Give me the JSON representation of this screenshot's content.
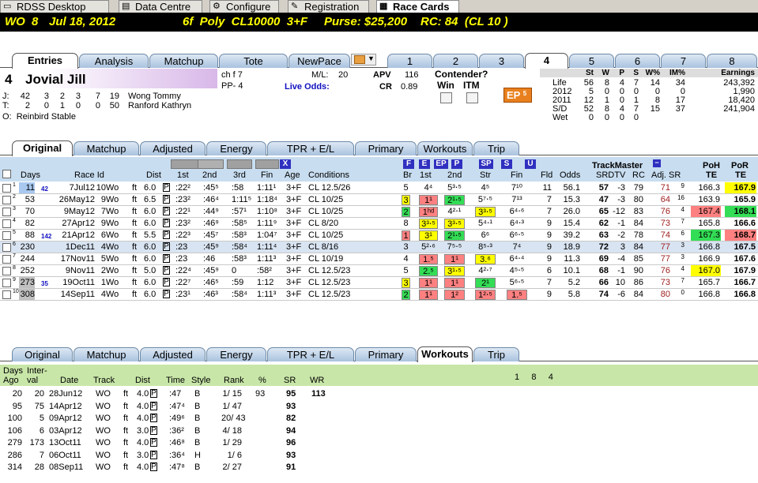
{
  "app_tabs": [
    {
      "label": "RDSS Desktop",
      "icon": "desktop-icon"
    },
    {
      "label": "Data Centre",
      "icon": "database-icon"
    },
    {
      "label": "Configure",
      "icon": "gear-icon"
    },
    {
      "label": "Registration",
      "icon": "registration-icon"
    },
    {
      "label": "Race Cards",
      "icon": "race-card-icon"
    }
  ],
  "header": {
    "track": "WO",
    "race": "8",
    "date": "Jul 18, 2012",
    "conditions": "6f  Poly  CL10000  3+F",
    "purse": "Purse: $25,200",
    "rc": "RC: 84  (CL 10 )"
  },
  "main_tabs": [
    "Entries",
    "Analysis",
    "Matchup",
    "Tote",
    "NewPace"
  ],
  "horse_tabs": [
    "1",
    "2",
    "3",
    "4",
    "5",
    "6",
    "7",
    "8"
  ],
  "horse": {
    "pp": "4",
    "name": "Jovial Jill",
    "desc": "ch f 7",
    "pp_label": "PP- 4",
    "ml_label": "M/L:",
    "ml": "20",
    "live_odds": "Live Odds:",
    "apv_label": "APV",
    "apv": "116",
    "cr_label": "CR",
    "cr": "0.89",
    "contender": "Contender?",
    "win": "Win",
    "itm": "ITM",
    "ep": "EP",
    "ep_num": "5",
    "jockey": {
      "tag": "J:",
      "stats": [
        "42",
        "3",
        "2",
        "3",
        "7",
        "19"
      ],
      "name": "Wong Tommy"
    },
    "trainer": {
      "tag": "T:",
      "stats": [
        "2",
        "0",
        "1",
        "0",
        "0",
        "50"
      ],
      "name": "Ranford Kathryn"
    },
    "owner": "O:  Reinbird Stable"
  },
  "record": {
    "headers": [
      "St",
      "W",
      "P",
      "S",
      "W%",
      "IM%",
      "Earnings"
    ],
    "rows": [
      [
        "Life",
        "56",
        "8",
        "4",
        "7",
        "14",
        "34",
        "243,392"
      ],
      [
        "2012",
        "5",
        "0",
        "0",
        "0",
        "0",
        "0",
        "1,990"
      ],
      [
        "2011",
        "12",
        "1",
        "0",
        "1",
        "8",
        "17",
        "18,420"
      ],
      [
        "S/D",
        "52",
        "8",
        "4",
        "7",
        "15",
        "37",
        "241,904"
      ],
      [
        "Wet",
        "0",
        "0",
        "0",
        "0",
        "",
        "",
        ""
      ]
    ]
  },
  "pp_tabs": [
    "Original",
    "Matchup",
    "Adjusted",
    "Energy",
    "TPR + E/L",
    "Primary",
    "Workouts",
    "Trip"
  ],
  "pp_headers": {
    "days": "Days",
    "race_id": "Race Id",
    "dist": "Dist",
    "first": "1st",
    "second": "2nd",
    "third": "3rd",
    "fin": "Fin",
    "age": "Age",
    "conditions": "Conditions",
    "br": "Br",
    "c1st": "1st",
    "c2nd": "2nd",
    "str": "Str",
    "cfin": "Fin",
    "fld": "Fld",
    "odds": "Odds",
    "trackmaster": "TrackMaster",
    "srdtv": "SRDTV",
    "rc": "RC",
    "adj_sr": "Adj. SR",
    "poh": "PoH",
    "por": "PoR",
    "te": "TE",
    "x": "X",
    "filter_labels": [
      "F",
      "E",
      "EP",
      "P",
      "SP",
      "S",
      "U"
    ]
  },
  "pp_rows": [
    {
      "n": "1",
      "days": "11",
      "small": "42",
      "date": "7Jul12",
      "race": "10",
      "trk": "Wo",
      "sf": "ft",
      "dist": "6.0",
      "f": ":22²",
      ":s": ":45⁵",
      "t": ":58",
      "fin": "1:11¹",
      "age": "3+F",
      "cond": "CL 12.5/26",
      "br": "5",
      "c1": "4⁴",
      "c1c": "",
      "c2": "5³⋅⁵",
      "c2c": "",
      "st": "4⁵",
      "stc": "",
      "fn": "7¹⁰",
      "fnc": "",
      "fld": "11",
      "odds": "56.1",
      "sr": "57",
      "dtv": "-3",
      "rc": "79",
      "adj": "71",
      "adjn": "9",
      "poh": "166.3",
      "pohc": "",
      "por": "167.9",
      "porc": "y"
    },
    {
      "n": "2",
      "days": "53",
      "small": "",
      "date": "26May12",
      "race": "9",
      "trk": "Wo",
      "sf": "ft",
      "dist": "6.5",
      "f": ":23²",
      ":s": ":46⁴",
      "t": "1:11⁵",
      "fin": "1:18⁴",
      "age": "3+F",
      "cond": "CL 10/25",
      "br": "3",
      "brc": "y",
      "c1": "1¹",
      "c1c": "p",
      "c2": "2¹⋅⁵",
      "c2c": "g",
      "st": "5⁷⋅⁵",
      "stc": "",
      "fn": "7¹³",
      "fnc": "",
      "fld": "7",
      "odds": "15.3",
      "sr": "47",
      "dtv": "-3",
      "rc": "80",
      "adj": "64",
      "adjn": "16",
      "poh": "163.9",
      "pohc": "",
      "por": "165.9",
      "porc": ""
    },
    {
      "n": "3",
      "days": "70",
      "small": "",
      "date": "9May12",
      "race": "7",
      "trk": "Wo",
      "sf": "ft",
      "dist": "6.0",
      "f": ":22¹",
      ":s": ":44⁹",
      "t": ":57¹",
      "fin": "1:10⁸",
      "age": "3+F",
      "cond": "CL 10/25",
      "br": "2",
      "brc": "g",
      "c1": "1ʰᵈ",
      "c1c": "p",
      "c2": "4²⋅¹",
      "c2c": "",
      "st": "3³⋅⁵",
      "stc": "y",
      "fn": "6⁴⋅⁶",
      "fnc": "",
      "fld": "7",
      "odds": "26.0",
      "sr": "65",
      "dtv": "-12",
      "rc": "83",
      "adj": "76",
      "adjn": "4",
      "poh": "167.4",
      "pohc": "p",
      "por": "168.1",
      "porc": "g"
    },
    {
      "n": "4",
      "days": "82",
      "small": "",
      "date": "27Apr12",
      "race": "9",
      "trk": "Wo",
      "sf": "ft",
      "dist": "6.0",
      "f": ":23²",
      ":s": ":46⁹",
      "t": ":58⁵",
      "fin": "1:11⁹",
      "age": "3+F",
      "cond": "CL 8/20",
      "br": "8",
      "c1": "3³⋅⁵",
      "c1c": "y",
      "c2": "3³⋅⁵",
      "c2c": "y",
      "st": "5⁴⋅¹",
      "stc": "",
      "fn": "6⁴⋅³",
      "fnc": "",
      "fld": "9",
      "odds": "15.4",
      "sr": "62",
      "dtv": "-1",
      "rc": "84",
      "adj": "73",
      "adjn": "7",
      "poh": "165.8",
      "pohc": "",
      "por": "166.6",
      "porc": ""
    },
    {
      "n": "5",
      "days": "88",
      "small": "142",
      "date": "21Apr12",
      "race": "6",
      "trk": "Wo",
      "sf": "ft",
      "dist": "5.5",
      "f": ":22³",
      ":s": ":45⁷",
      "t": ":58³",
      "fin": "1:04⁷",
      "age": "3+F",
      "cond": "CL 10/25",
      "br": "1",
      "brc": "p",
      "c1": "3¹",
      "c1c": "y",
      "c2": "2¹⋅⁵",
      "c2c": "g",
      "st": "6⁶",
      "stc": "",
      "fn": "6⁶⋅⁵",
      "fnc": "",
      "fld": "9",
      "odds": "39.2",
      "sr": "63",
      "dtv": "-2",
      "rc": "78",
      "adj": "74",
      "adjn": "6",
      "poh": "167.3",
      "pohc": "g",
      "por": "168.7",
      "porc": "p"
    },
    {
      "n": "6",
      "days": "230",
      "small": "",
      "date": "1Dec11",
      "race": "4",
      "trk": "Wo",
      "sf": "ft",
      "dist": "6.0",
      "f": ":23",
      ":s": ":45⁹",
      "t": ":58⁴",
      "fin": "1:11⁴",
      "age": "3+F",
      "cond": "CL 8/16",
      "br": "3",
      "c1": "5²⋅⁶",
      "c1c": "",
      "c2": "7⁵⋅⁵",
      "c2c": "",
      "st": "8⁵⋅³",
      "stc": "",
      "fn": "7⁴",
      "fnc": "",
      "fld": "9",
      "odds": "18.9",
      "sr": "72",
      "dtv": "3",
      "rc": "84",
      "adj": "77",
      "adjn": "3",
      "poh": "166.8",
      "pohc": "",
      "por": "167.5",
      "porc": "",
      "sel": true
    },
    {
      "n": "7",
      "days": "244",
      "small": "",
      "date": "17Nov11",
      "race": "5",
      "trk": "Wo",
      "sf": "ft",
      "dist": "6.0",
      "f": ":23",
      ":s": ":46",
      "t": ":58³",
      "fin": "1:11³",
      "age": "3+F",
      "cond": "CL 10/19",
      "br": "4",
      "c1": "1.⁵",
      "c1c": "p",
      "c2": "1¹",
      "c2c": "p",
      "st": "3.⁶",
      "stc": "y",
      "fn": "6⁴⋅⁴",
      "fnc": "",
      "fld": "9",
      "odds": "11.3",
      "sr": "69",
      "dtv": "-4",
      "rc": "85",
      "adj": "77",
      "adjn": "3",
      "poh": "166.9",
      "pohc": "",
      "por": "167.6",
      "porc": ""
    },
    {
      "n": "8",
      "days": "252",
      "small": "",
      "date": "9Nov11",
      "race": "2",
      "trk": "Wo",
      "sf": "ft",
      "dist": "5.0",
      "f": ":22⁴",
      ":s": ":45⁹",
      "t": "0",
      "fin": ":58²",
      "age": "3+F",
      "cond": "CL 12.5/23",
      "br": "5",
      "c1": "2.⁵",
      "c1c": "g",
      "c2": "3¹⋅⁵",
      "c2c": "y",
      "st": "4²⋅⁷",
      "stc": "",
      "fn": "4⁵⋅⁵",
      "fnc": "",
      "fld": "6",
      "odds": "10.1",
      "sr": "68",
      "dtv": "-1",
      "rc": "90",
      "adj": "76",
      "adjn": "4",
      "poh": "167.0",
      "pohc": "y",
      "por": "167.9",
      "porc": ""
    },
    {
      "n": "9",
      "days": "273",
      "small": "35",
      "date": "19Oct11",
      "race": "1",
      "trk": "Wo",
      "sf": "ft",
      "dist": "6.0",
      "f": ":22⁷",
      ":s": ":46⁵",
      "t": ":59",
      "fin": "1:12",
      "age": "3+F",
      "cond": "CL 12.5/23",
      "br": "3",
      "brc": "y",
      "c1": "1¹",
      "c1c": "p",
      "c2": "1¹",
      "c2c": "p",
      "st": "2¹",
      "stc": "g",
      "fn": "5⁶⋅⁵",
      "fnc": "",
      "fld": "7",
      "odds": "5.2",
      "sr": "66",
      "dtv": "10",
      "rc": "86",
      "adj": "73",
      "adjn": "7",
      "poh": "165.7",
      "pohc": "",
      "por": "166.7",
      "porc": ""
    },
    {
      "n": "10",
      "days": "308",
      "small": "",
      "date": "14Sep11",
      "race": "4",
      "trk": "Wo",
      "sf": "ft",
      "dist": "6.0",
      "f": ":23¹",
      ":s": ":46³",
      "t": ":58⁴",
      "fin": "1:11³",
      "age": "3+F",
      "cond": "CL 12.5/23",
      "br": "2",
      "brc": "g",
      "c1": "1¹",
      "c1c": "p",
      "c2": "1²",
      "c2c": "p",
      "st": "1²⋅⁵",
      "stc": "p",
      "fn": "1.⁵",
      "fnc": "p",
      "fld": "9",
      "odds": "5.8",
      "sr": "74",
      "dtv": "-6",
      "rc": "84",
      "adj": "80",
      "adjn": "0",
      "poh": "166.8",
      "pohc": "",
      "por": "166.8",
      "porc": ""
    }
  ],
  "wk_tabs": [
    "Original",
    "Matchup",
    "Adjusted",
    "Energy",
    "TPR + E/L",
    "Primary",
    "Workouts",
    "Trip"
  ],
  "wk_headers": {
    "days_ago": "Days\nAgo",
    "interval": "Inter-\nval",
    "date": "Date",
    "track": "Track",
    "dist": "Dist",
    "time": "Time",
    "style": "Style",
    "rank": "Rank",
    "pct": "%",
    "sr": "SR",
    "wr": "WR",
    "extra": "1     8     4"
  },
  "workouts": [
    {
      "days": "20",
      "int": "20",
      "date": "28Jun12",
      "trk": "WO",
      "sf": "ft",
      "dist": "4.0",
      "time": ":47",
      "style": "B",
      "rank": "1/ 15",
      "pct": "93",
      "sr": "95",
      "wr": "113"
    },
    {
      "days": "95",
      "int": "75",
      "date": "14Apr12",
      "trk": "WO",
      "sf": "ft",
      "dist": "4.0",
      "time": ":47⁴",
      "style": "B",
      "rank": "1/ 47",
      "pct": "",
      "sr": "93",
      "wr": ""
    },
    {
      "days": "100",
      "int": "5",
      "date": "09Apr12",
      "trk": "WO",
      "sf": "ft",
      "dist": "4.0",
      "time": ":49⁶",
      "style": "B",
      "rank": "20/ 43",
      "pct": "",
      "sr": "82",
      "wr": ""
    },
    {
      "days": "106",
      "int": "6",
      "date": "03Apr12",
      "trk": "WO",
      "sf": "ft",
      "dist": "3.0",
      "time": ":36²",
      "style": "B",
      "rank": "4/ 18",
      "pct": "",
      "sr": "94",
      "wr": ""
    },
    {
      "days": "279",
      "int": "173",
      "date": "13Oct11",
      "trk": "WO",
      "sf": "ft",
      "dist": "4.0",
      "time": ":46⁸",
      "style": "B",
      "rank": "1/ 29",
      "pct": "",
      "sr": "96",
      "wr": ""
    },
    {
      "days": "286",
      "int": "7",
      "date": "06Oct11",
      "trk": "WO",
      "sf": "ft",
      "dist": "3.0",
      "time": ":36⁴",
      "style": "H",
      "rank": "1/ 6",
      "pct": "",
      "sr": "93",
      "wr": ""
    },
    {
      "days": "314",
      "int": "28",
      "date": "08Sep11",
      "trk": "WO",
      "sf": "ft",
      "dist": "4.0",
      "time": ":47⁸",
      "style": "B",
      "rank": "2/ 27",
      "pct": "",
      "sr": "91",
      "wr": ""
    }
  ]
}
